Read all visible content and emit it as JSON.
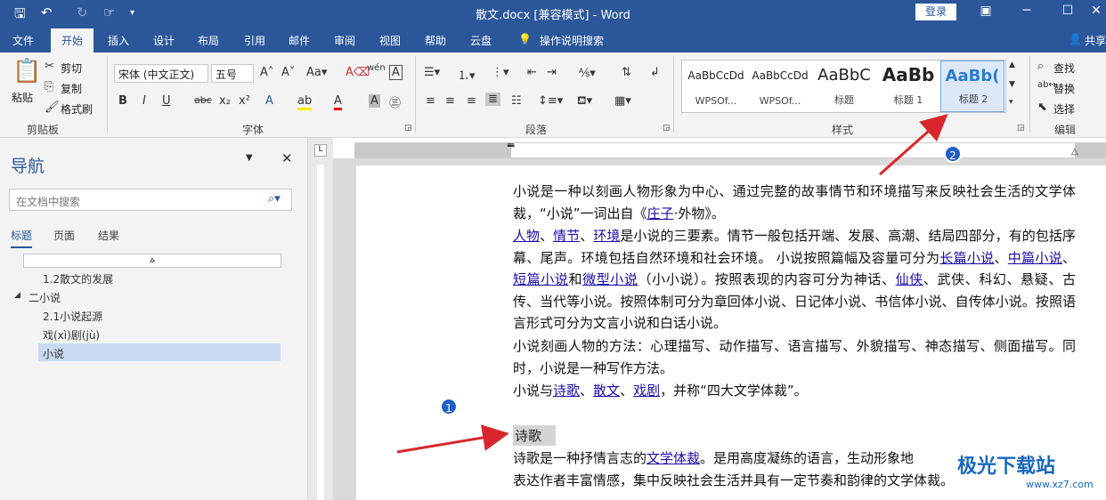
{
  "titlebar": {
    "title": "散文.docx [兼容模式]  -  Word",
    "login": "登录"
  },
  "tabs": [
    "文件",
    "开始",
    "插入",
    "设计",
    "布局",
    "引用",
    "邮件",
    "审阅",
    "视图",
    "帮助",
    "云盘",
    "操作说明搜索"
  ],
  "share": "共享",
  "ribbon": {
    "clipboard": {
      "paste": "粘贴",
      "cut": "剪切",
      "copy": "复制",
      "painter": "格式刷",
      "label": "剪贴板"
    },
    "font": {
      "family": "宋体 (中文正文)",
      "size": "五号",
      "label": "字体"
    },
    "paragraph": {
      "label": "段落"
    },
    "styles": {
      "label": "样式",
      "items": [
        {
          "preview": "AaBbCcDd",
          "name": "WPSOf..."
        },
        {
          "preview": "AaBbCcDd",
          "name": "WPSOf..."
        },
        {
          "preview": "AaBbC",
          "name": "标题"
        },
        {
          "preview": "AaBb",
          "name": "标题 1"
        },
        {
          "preview": "AaBb(",
          "name": "标题 2"
        }
      ]
    },
    "editing": {
      "find": "查找",
      "replace": "替换",
      "select": "选择",
      "label": "编辑"
    }
  },
  "nav": {
    "title": "导航",
    "search_placeholder": "在文档中搜索",
    "tabs": [
      "标题",
      "页面",
      "结果"
    ],
    "items": [
      "1.2散文的发展",
      "二小说",
      "2.1小说起源",
      "戏(xì)剧(jù)",
      "小说"
    ]
  },
  "doc": {
    "p1": [
      "小说是一种以刻画人物形象为中心、通过完整的故事情节和环境描写来反映社会生活的文学体裁，“小说”一词出自《",
      "庄子",
      "·外物》。"
    ],
    "p2": [
      "人物",
      "、",
      "情节",
      "、",
      "环境",
      "是小说的三要素。情节一般包括开端、发展、高潮、结局四部分，有的包括序幕、尾声。环境包括自然环境和社会环境。 小说按照篇幅及容量可分为",
      "长篇小说",
      "、",
      "中篇小说",
      "、",
      "短篇小说",
      "和",
      "微型小说",
      "（小小说）。按照表现的内容可分为神话、",
      "仙侠",
      "、武侠、科幻、悬疑、古传、当代等小说。按照体制可分为章回体小说、日记体小说、书信体小说、自传体小说。按照语言形式可分为文言小说和白话小说。"
    ],
    "p3": "小说刻画人物的方法：心理描写、动作描写、语言描写、外貌描写、神态描写、侧面描写。同时，小说是一种写作方法。",
    "p4": [
      "小说与",
      "诗歌",
      "、",
      "散文",
      "、",
      "戏剧",
      "，并称“四大文学体裁”。"
    ],
    "heading": "诗歌",
    "p5": [
      "诗歌是一种抒情言志的",
      "文学体裁",
      "。是用高度凝练的语言，生动形象地"
    ],
    "p6": "表达作者丰富情感，集中反映社会生活并具有一定节奏和韵律的文学体裁。"
  },
  "badges": [
    "1",
    "2"
  ],
  "watermark": {
    "brand": "极光下载站",
    "url": "www.xz7.com"
  },
  "colors": {
    "accent": "#2b579a",
    "arrow": "#d9262c",
    "badge": "#1f5fc8"
  }
}
